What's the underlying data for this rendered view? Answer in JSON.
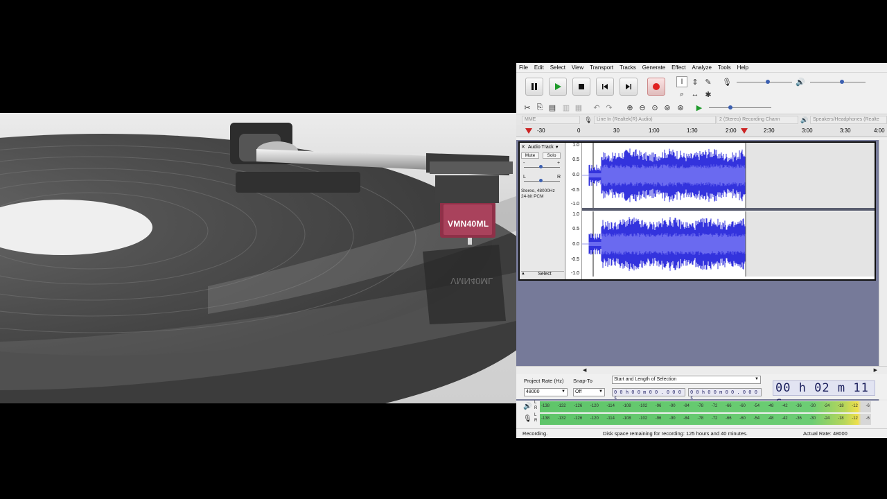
{
  "photo": {
    "cartridge_label": "VMN40ML"
  },
  "audacity": {
    "menu": [
      "File",
      "Edit",
      "Select",
      "View",
      "Transport",
      "Tracks",
      "Generate",
      "Effect",
      "Analyze",
      "Tools",
      "Help"
    ],
    "transport": {
      "pause_icon": "pause-icon",
      "play_icon": "play-icon",
      "stop_icon": "stop-icon",
      "skip_start_icon": "skip-start-icon",
      "skip_end_icon": "skip-end-icon",
      "record_icon": "record-icon"
    },
    "devices": {
      "host": "MME",
      "recording_device": "Line In (Realtek(R) Audio)",
      "channels": "2 (Stereo) Recording Chann",
      "playback_device": "Speakers/Headphones (Realte"
    },
    "ruler": {
      "ticks": [
        "-30",
        "0",
        "30",
        "1:00",
        "1:30",
        "2:00",
        "2:30",
        "3:00",
        "3:30",
        "4:00"
      ]
    },
    "track": {
      "name": "Audio Track",
      "mute_label": "Mute",
      "solo_label": "Solo",
      "gain_minus": "-",
      "gain_plus": "+",
      "pan_left": "L",
      "pan_right": "R",
      "info_line1": "Stereo, 48000Hz",
      "info_line2": "24-bit PCM",
      "select_label": "Select",
      "scale": [
        "1.0",
        "0.5",
        "0.0",
        "-0.5",
        "-1.0"
      ],
      "recorded_fraction": 0.56
    },
    "selection_toolbar": {
      "project_rate_label": "Project Rate (Hz)",
      "snap_to_label": "Snap-To",
      "selection_mode": "Start and Length of Selection",
      "project_rate_value": "48000",
      "snap_to_value": "Off",
      "start_time": "0 0 h 0 0 m 0 0 . 0 0 0 s",
      "length_time": "0 0 h 0 0 m 0 0 . 0 0 0 s",
      "audio_position": "00 h 02 m 11 s"
    },
    "meters": {
      "scale": [
        "-138",
        "-132",
        "-126",
        "-120",
        "-114",
        "-108",
        "-102",
        "-96",
        "-90",
        "-84",
        "-78",
        "-72",
        "-66",
        "-60",
        "-54",
        "-48",
        "-42",
        "-36",
        "-30",
        "-24",
        "-18",
        "-12",
        "-6"
      ],
      "channel_l": "L",
      "channel_r": "R"
    },
    "status": {
      "state": "Recording.",
      "disk_space": "Disk space remaining for recording: 125 hours and 40 minutes.",
      "actual_rate": "Actual Rate: 48000"
    }
  }
}
